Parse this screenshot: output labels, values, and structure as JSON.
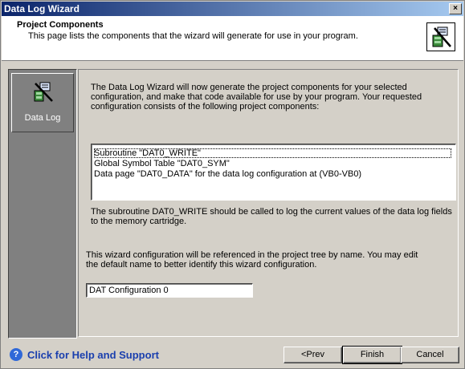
{
  "window": {
    "title": "Data Log Wizard",
    "close_label": "×"
  },
  "header": {
    "title": "Project Components",
    "subtitle": "This page lists the components that the wizard will generate for use in your program."
  },
  "sidebar": {
    "items": [
      {
        "label": "Data Log"
      }
    ]
  },
  "content": {
    "intro": "The Data Log Wizard will now generate the project components for your selected configuration, and make that code available for use by your program. Your requested configuration consists of the following project components:",
    "components": [
      "Subroutine \"DAT0_WRITE\"",
      "Global Symbol Table \"DAT0_SYM\"",
      "Data page \"DAT0_DATA\" for the data log configuration at (VB0-VB0)"
    ],
    "note": "The subroutine DAT0_WRITE should be called to log the current values of the data log fields to the memory cartridge.",
    "name_instruction": "This wizard configuration will be referenced in the project tree by name. You may edit the default name to better identify this wizard configuration.",
    "config_name": "DAT Configuration 0"
  },
  "footer": {
    "help_label": "Click for Help and Support",
    "help_icon": "?",
    "prev_label": "<Prev",
    "finish_label": "Finish",
    "cancel_label": "Cancel"
  }
}
